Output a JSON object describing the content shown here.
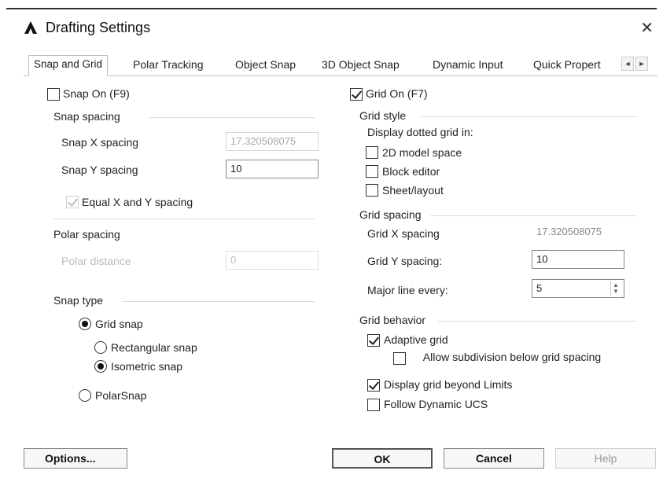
{
  "window": {
    "title": "Drafting Settings",
    "icon": "autocad-a-icon"
  },
  "tabs": [
    {
      "label": "Snap and Grid"
    },
    {
      "label": "Polar Tracking"
    },
    {
      "label": "Object Snap"
    },
    {
      "label": "3D Object Snap"
    },
    {
      "label": "Dynamic Input"
    },
    {
      "label": "Quick Propert"
    }
  ],
  "snap": {
    "snap_on": {
      "label": "Snap On (F9)",
      "checked": false
    },
    "spacing_group": "Snap spacing",
    "x_label": "Snap X spacing",
    "x_value": "17.320508075",
    "y_label": "Snap Y spacing",
    "y_value": "10",
    "equal_label": "Equal X and Y spacing",
    "polar_group": "Polar spacing",
    "polar_distance_label": "Polar distance",
    "polar_distance_value": "0",
    "type_group": "Snap type",
    "grid_snap": "Grid snap",
    "rectangular": "Rectangular snap",
    "isometric": "Isometric snap",
    "polarsnap": "PolarSnap"
  },
  "grid": {
    "grid_on": {
      "label": "Grid On (F7)",
      "checked": true
    },
    "style_group": "Grid style",
    "dotted_label": "Display dotted grid in:",
    "model_space": "2D model space",
    "block_editor": "Block editor",
    "sheet_layout": "Sheet/layout",
    "spacing_group": "Grid spacing",
    "x_label": "Grid X spacing",
    "x_value": "17.320508075",
    "y_label": "Grid Y spacing:",
    "y_value": "10",
    "major_label": "Major line every:",
    "major_value": "5",
    "behavior_group": "Grid behavior",
    "adaptive": "Adaptive grid",
    "allow_subdivision": "Allow subdivision below grid spacing",
    "beyond_limits": "Display grid beyond Limits",
    "follow_ucs": "Follow Dynamic UCS"
  },
  "buttons": {
    "options": "Options...",
    "ok": "OK",
    "cancel": "Cancel",
    "help": "Help"
  }
}
